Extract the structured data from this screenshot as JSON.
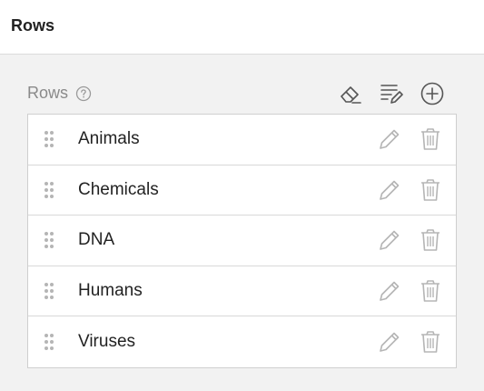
{
  "header": {
    "title": "Rows"
  },
  "section": {
    "label": "Rows",
    "help_icon": "question-circle-icon"
  },
  "toolbar": {
    "items": [
      {
        "icon": "eraser-icon"
      },
      {
        "icon": "edit-list-icon"
      },
      {
        "icon": "plus-circle-icon"
      }
    ]
  },
  "rows": [
    {
      "label": "Animals"
    },
    {
      "label": "Chemicals"
    },
    {
      "label": "DNA"
    },
    {
      "label": "Humans"
    },
    {
      "label": "Viruses"
    }
  ],
  "colors": {
    "icon_dark": "#555555",
    "icon_light": "#b5b5b5",
    "text": "#222222",
    "muted": "#8a8a8a"
  }
}
